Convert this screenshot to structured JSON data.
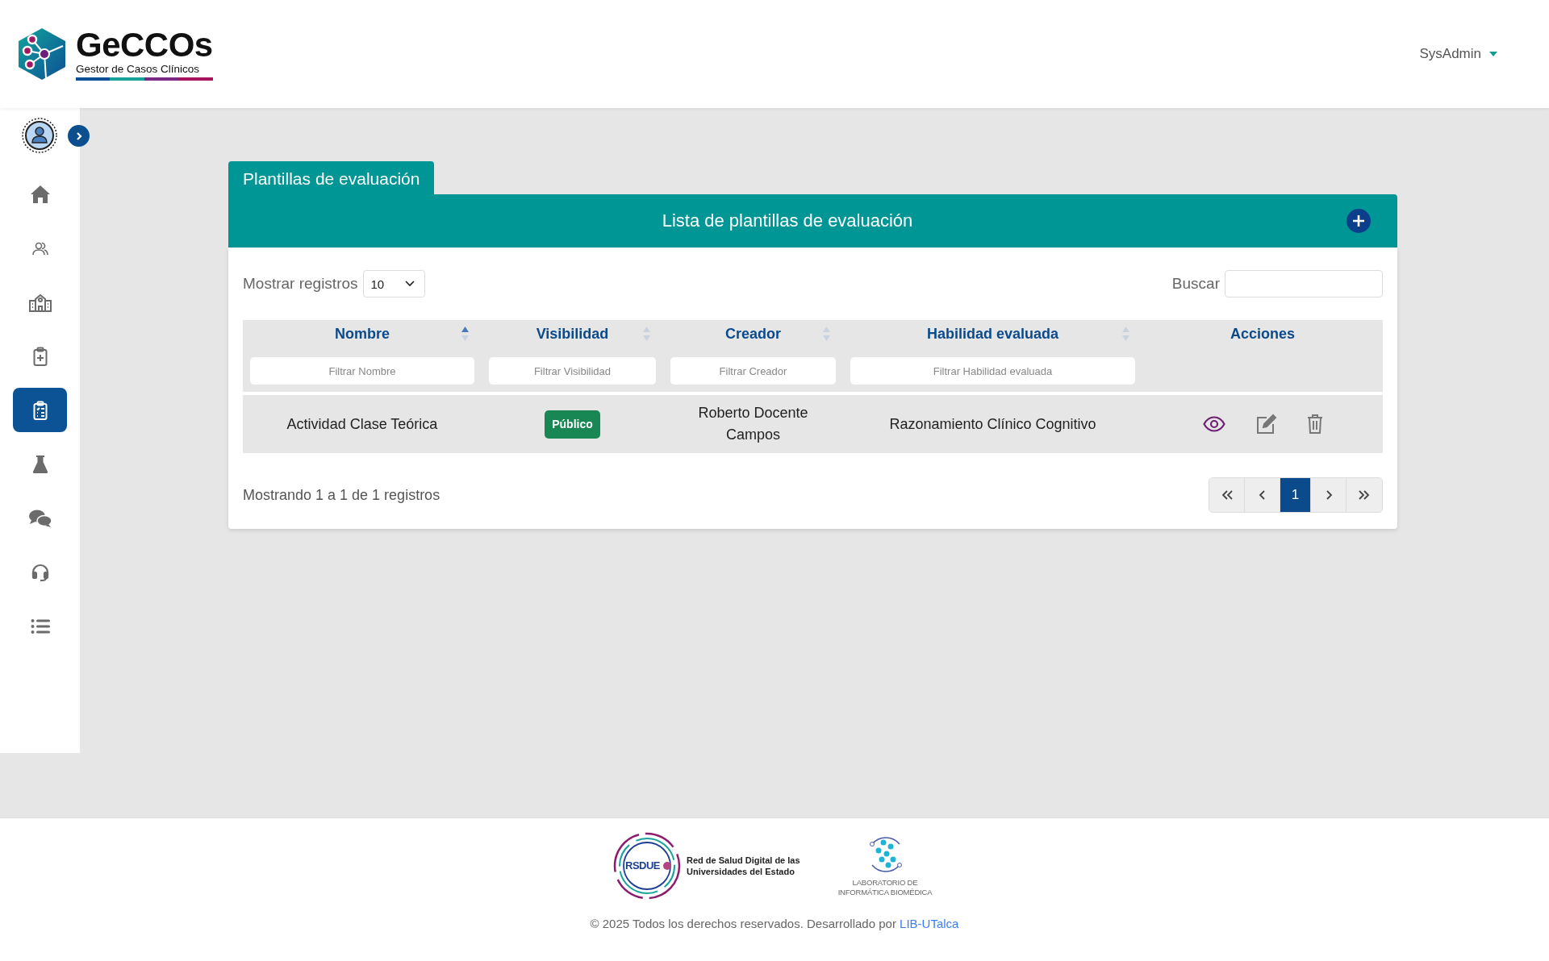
{
  "header": {
    "logo": {
      "title": "GeCCOs",
      "subtitle": "Gestor de Casos Clínicos"
    },
    "user_menu": "SysAdmin"
  },
  "sidebar": {
    "items": [
      {
        "kind": "home",
        "selected": false
      },
      {
        "kind": "users",
        "selected": false
      },
      {
        "kind": "school",
        "selected": false
      },
      {
        "kind": "clipboard-plus",
        "selected": false
      },
      {
        "kind": "clipboard-list",
        "selected": true
      },
      {
        "kind": "flask",
        "selected": false
      },
      {
        "kind": "comments",
        "selected": false
      },
      {
        "kind": "headset",
        "selected": false
      },
      {
        "kind": "list",
        "selected": false
      }
    ]
  },
  "page": {
    "tab": "Plantillas de evaluación",
    "card_title": "Lista de plantillas de evaluación",
    "length_label": "Mostrar registros",
    "length_value": "10",
    "search_label": "Buscar",
    "table": {
      "columns": [
        {
          "label": "Nombre",
          "sorted": true,
          "filter_placeholder": "Filtrar Nombre"
        },
        {
          "label": "Visibilidad",
          "sorted": false,
          "filter_placeholder": "Filtrar Visibilidad"
        },
        {
          "label": "Creador",
          "sorted": false,
          "filter_placeholder": "Filtrar Creador"
        },
        {
          "label": "Habilidad evaluada",
          "sorted": false,
          "filter_placeholder": "Filtrar Habilidad evaluada"
        },
        {
          "label": "Acciones"
        }
      ],
      "rows": [
        {
          "nombre": "Actividad Clase Teórica",
          "visibilidad": "Público",
          "creador": "Roberto Docente Campos",
          "habilidad": "Razonamiento Clínico Cognitivo"
        }
      ]
    },
    "info": "Mostrando 1 a 1 de 1 registros",
    "pagination": {
      "pages": [
        {
          "label": "1",
          "selected": true
        }
      ]
    }
  },
  "footer": {
    "partners": [
      {
        "kind": "rsdue",
        "mark": "RSDUE",
        "text": "Red de Salud Digital de las Universidades del Estado"
      },
      {
        "kind": "lab",
        "text": "LABORATORIO DE INFORMÁTICA BIOMÉDICA"
      }
    ],
    "copyright": "© 2025 Todos los derechos reservados. Desarrollado por",
    "link": "LIB-UTalca"
  }
}
